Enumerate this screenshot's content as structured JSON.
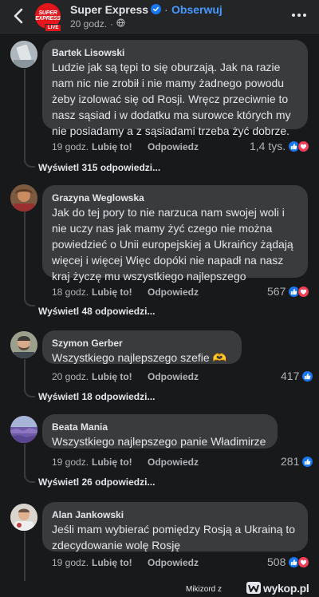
{
  "header": {
    "page_name": "Super Express",
    "brand_line1": "SUPER",
    "brand_line2": "EXPRESS",
    "live_label": "LIVE",
    "separator": "·",
    "follow_label": "Obserwuj",
    "time": "20 godz.",
    "meta_dot": "·"
  },
  "comments": [
    {
      "author": "Bartek Lisowski",
      "lines": [
        "Ludzie jak są tępi to się oburzają. Jak na razie",
        "nam nic nie zrobił i nie mamy żadnego powodu",
        "żeby izolować się od Rosji. Wręcz przeciwnie to",
        "nasz sąsiad  i w dodatku ma surowce których my",
        "nie posiadamy a z sąsiadami trzeba żyć dobrze."
      ],
      "time": "19 godz.",
      "like_label": "Lubię to!",
      "reply_label": "Odpowiedz",
      "reaction_count": "1,4 tys.",
      "view_replies": "Wyświetl 315 odpowiedzi..."
    },
    {
      "author": "Grazyna Weglowska",
      "lines": [
        "Jak do tej pory to nie narzuca nam swojej woli i",
        "nie uczy nas jak mamy żyć  czego nie można",
        "powiedzieć o Unii europejskiej a Ukraińcy żądają",
        "więcej i więcej Więc dopóki nie napadł na nasz",
        "kraj życzę mu wszystkiego najlepszego"
      ],
      "time": "18 godz.",
      "like_label": "Lubię to!",
      "reply_label": "Odpowiedz",
      "reaction_count": "567",
      "view_replies": "Wyświetl 48 odpowiedzi..."
    },
    {
      "author": "Szymon Gerber",
      "lines": [
        "Wszystkiego najlepszego szefie 🫶"
      ],
      "time": "20 godz.",
      "like_label": "Lubię to!",
      "reply_label": "Odpowiedz",
      "reaction_count": "417",
      "view_replies": "Wyświetl 18 odpowiedzi..."
    },
    {
      "author": "Beata Mania",
      "lines": [
        "Wszystkiego najlepszego panie Władimirze"
      ],
      "time": "19 godz.",
      "like_label": "Lubię to!",
      "reply_label": "Odpowiedz",
      "reaction_count": "281",
      "view_replies": "Wyświetl 26 odpowiedzi..."
    },
    {
      "author": "Alan Jankowski",
      "lines": [
        "Jeśli mam wybierać pomiędzy Rosją a Ukrainą to",
        "zdecydowanie wolę Rosję"
      ],
      "time": "19 godz.",
      "like_label": "Lubię to!",
      "reply_label": "Odpowiedz",
      "reaction_count": "508"
    }
  ],
  "watermark": {
    "user": "Mikizord",
    "via": "z",
    "site": "wykop.pl"
  },
  "colors": {
    "background": "#18191a",
    "bubble": "#3a3b3c",
    "link_blue": "#4599ff",
    "like_blue": "#1877f2",
    "heart_red": "#f33e58",
    "brand_red": "#e3161c"
  },
  "icons": [
    "back-arrow-icon",
    "verified-badge-icon",
    "globe-icon",
    "more-options-icon",
    "like-reaction-icon",
    "love-reaction-icon",
    "wykop-logo-icon"
  ]
}
